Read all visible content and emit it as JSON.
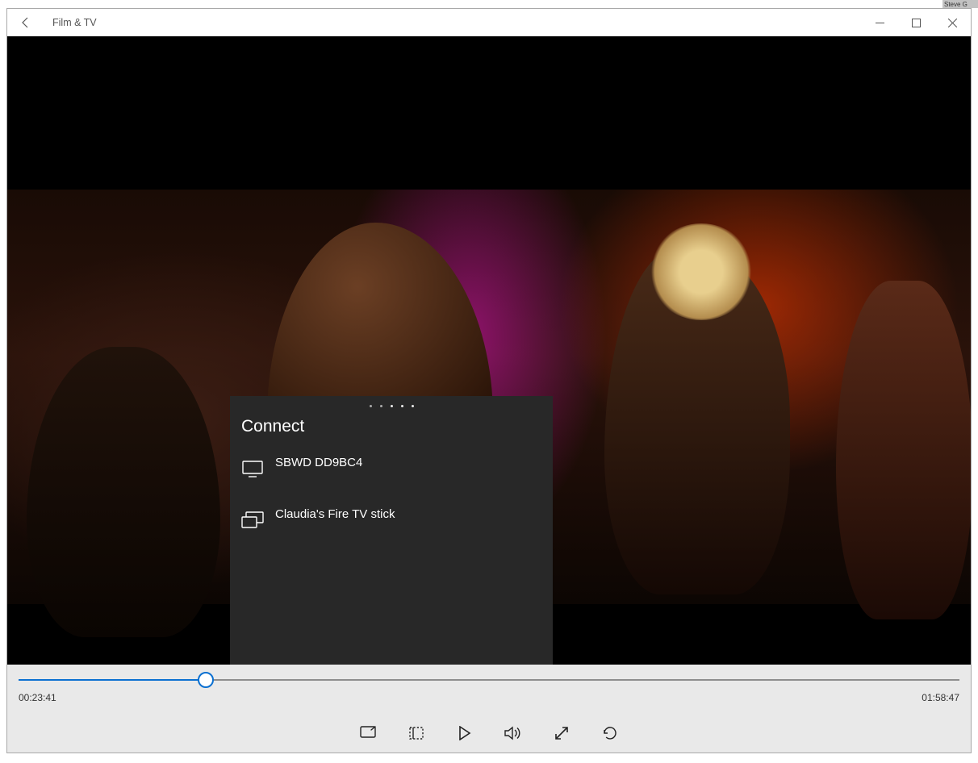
{
  "bg_tab_fragment": "Steve G",
  "titlebar": {
    "app_title": "Film & TV"
  },
  "flyout": {
    "heading": "Connect",
    "devices": [
      {
        "name": "SBWD DD9BC4",
        "icon": "monitor"
      },
      {
        "name": "Claudia's Fire TV stick",
        "icon": "multi-monitor"
      }
    ]
  },
  "playback": {
    "current_time": "00:23:41",
    "total_time": "01:58:47",
    "progress_fraction": 0.199
  }
}
